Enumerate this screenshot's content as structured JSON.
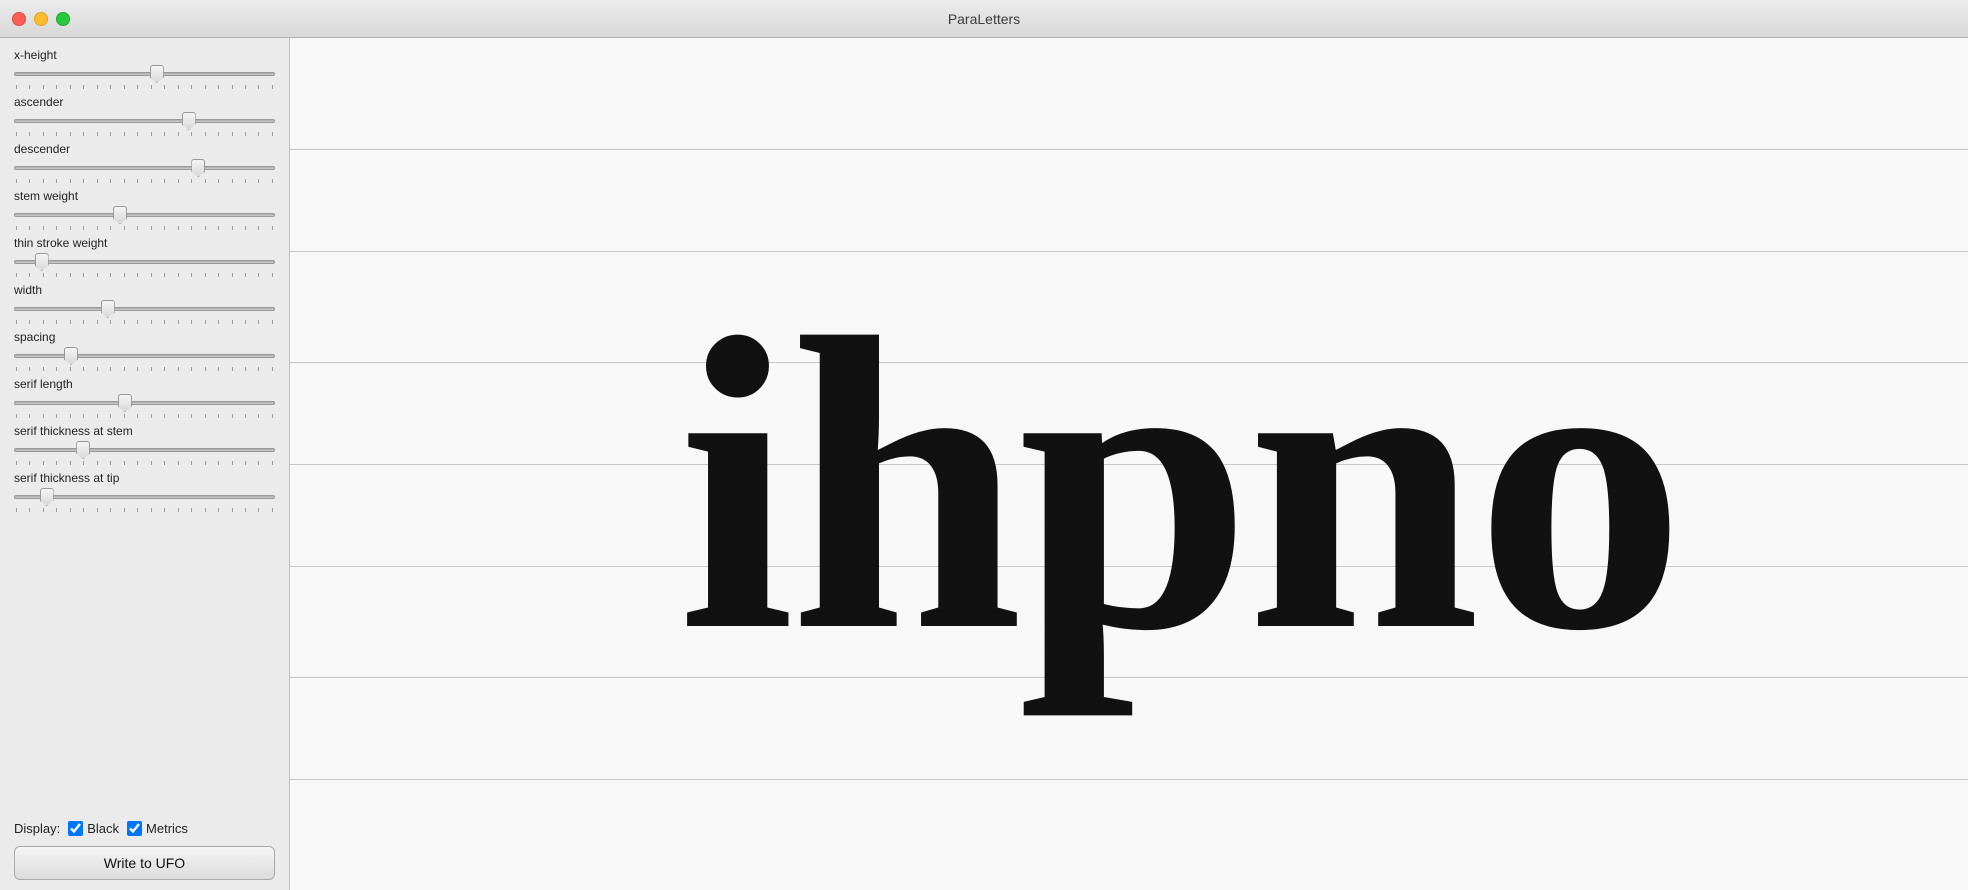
{
  "app": {
    "title": "ParaLetters"
  },
  "window_controls": {
    "close_label": "",
    "minimize_label": "",
    "maximize_label": ""
  },
  "sidebar": {
    "sliders": [
      {
        "id": "x-height",
        "label": "x-height",
        "value": 55,
        "min": 0,
        "max": 100
      },
      {
        "id": "ascender",
        "label": "ascender",
        "value": 68,
        "min": 0,
        "max": 100
      },
      {
        "id": "descender",
        "label": "descender",
        "value": 72,
        "min": 0,
        "max": 100
      },
      {
        "id": "stem-weight",
        "label": "stem weight",
        "value": 40,
        "min": 0,
        "max": 100
      },
      {
        "id": "thin-stroke-weight",
        "label": "thin stroke weight",
        "value": 8,
        "min": 0,
        "max": 100
      },
      {
        "id": "width",
        "label": "width",
        "value": 35,
        "min": 0,
        "max": 100
      },
      {
        "id": "spacing",
        "label": "spacing",
        "value": 20,
        "min": 0,
        "max": 100
      },
      {
        "id": "serif-length",
        "label": "serif length",
        "value": 42,
        "min": 0,
        "max": 100
      },
      {
        "id": "serif-thickness-stem",
        "label": "serif thickness at stem",
        "value": 25,
        "min": 0,
        "max": 100
      },
      {
        "id": "serif-thickness-tip",
        "label": "serif thickness at tip",
        "value": 10,
        "min": 0,
        "max": 100
      }
    ],
    "display_label": "Display:",
    "black_checkbox_label": "Black",
    "metrics_checkbox_label": "Metrics",
    "black_checked": true,
    "metrics_checked": true,
    "write_ufo_label": "Write to UFO"
  },
  "preview": {
    "text": "ihpno",
    "guide_lines": [
      13,
      25,
      38,
      50,
      62,
      75,
      87
    ]
  }
}
